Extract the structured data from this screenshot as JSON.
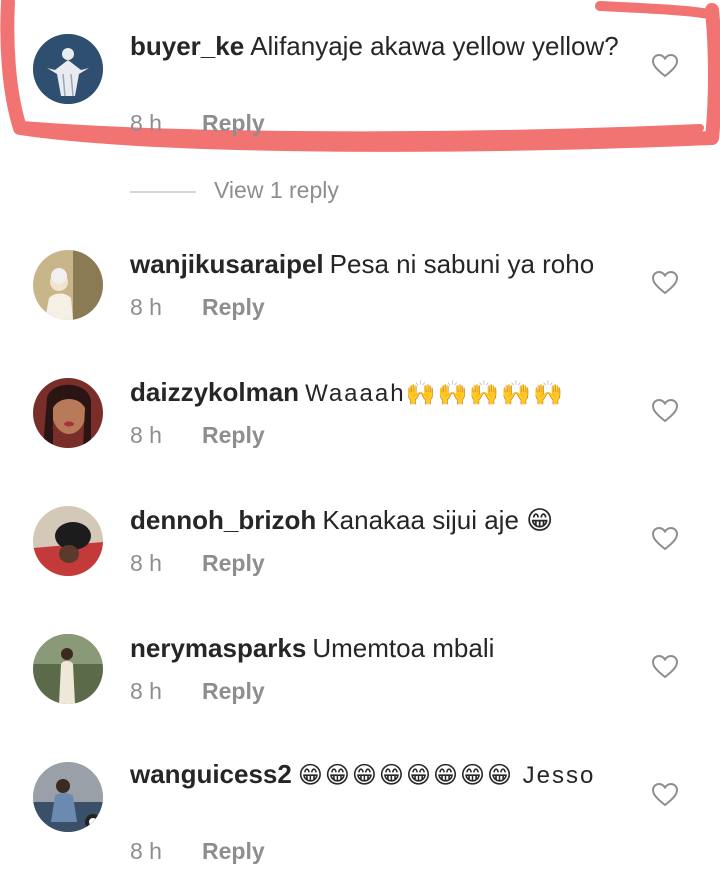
{
  "comments": [
    {
      "username": "buyer_ke",
      "text": "Alifanyaje akawa yellow yellow?",
      "time": "8 h",
      "reply": "Reply",
      "view_replies": "View 1 reply",
      "avatar_icon": "statue-avatar-icon",
      "highlighted": true
    },
    {
      "username": "wanjikusaraipel",
      "text": "Pesa ni sabuni ya roho",
      "time": "8 h",
      "reply": "Reply",
      "avatar_icon": "photo-avatar-icon"
    },
    {
      "username": "daizzykolman",
      "text": "Waaaah🙌🙌🙌🙌🙌",
      "time": "8 h",
      "reply": "Reply",
      "avatar_icon": "photo-avatar-icon"
    },
    {
      "username": "dennoh_brizoh",
      "text": "Kanakaa sijui aje 😁",
      "time": "8 h",
      "reply": "Reply",
      "avatar_icon": "photo-avatar-icon"
    },
    {
      "username": "nerymasparks",
      "text": "Umemtoa mbali",
      "time": "8 h",
      "reply": "Reply",
      "avatar_icon": "photo-avatar-icon"
    },
    {
      "username": "wanguicess2",
      "text": "😁😁😁😁😁😁😁😁 Jesso",
      "time": "8 h",
      "reply": "Reply",
      "avatar_icon": "photo-avatar-icon"
    }
  ],
  "colors": {
    "highlight_stroke": "#f27472",
    "text": "#262626",
    "muted": "#8e8e8e"
  }
}
